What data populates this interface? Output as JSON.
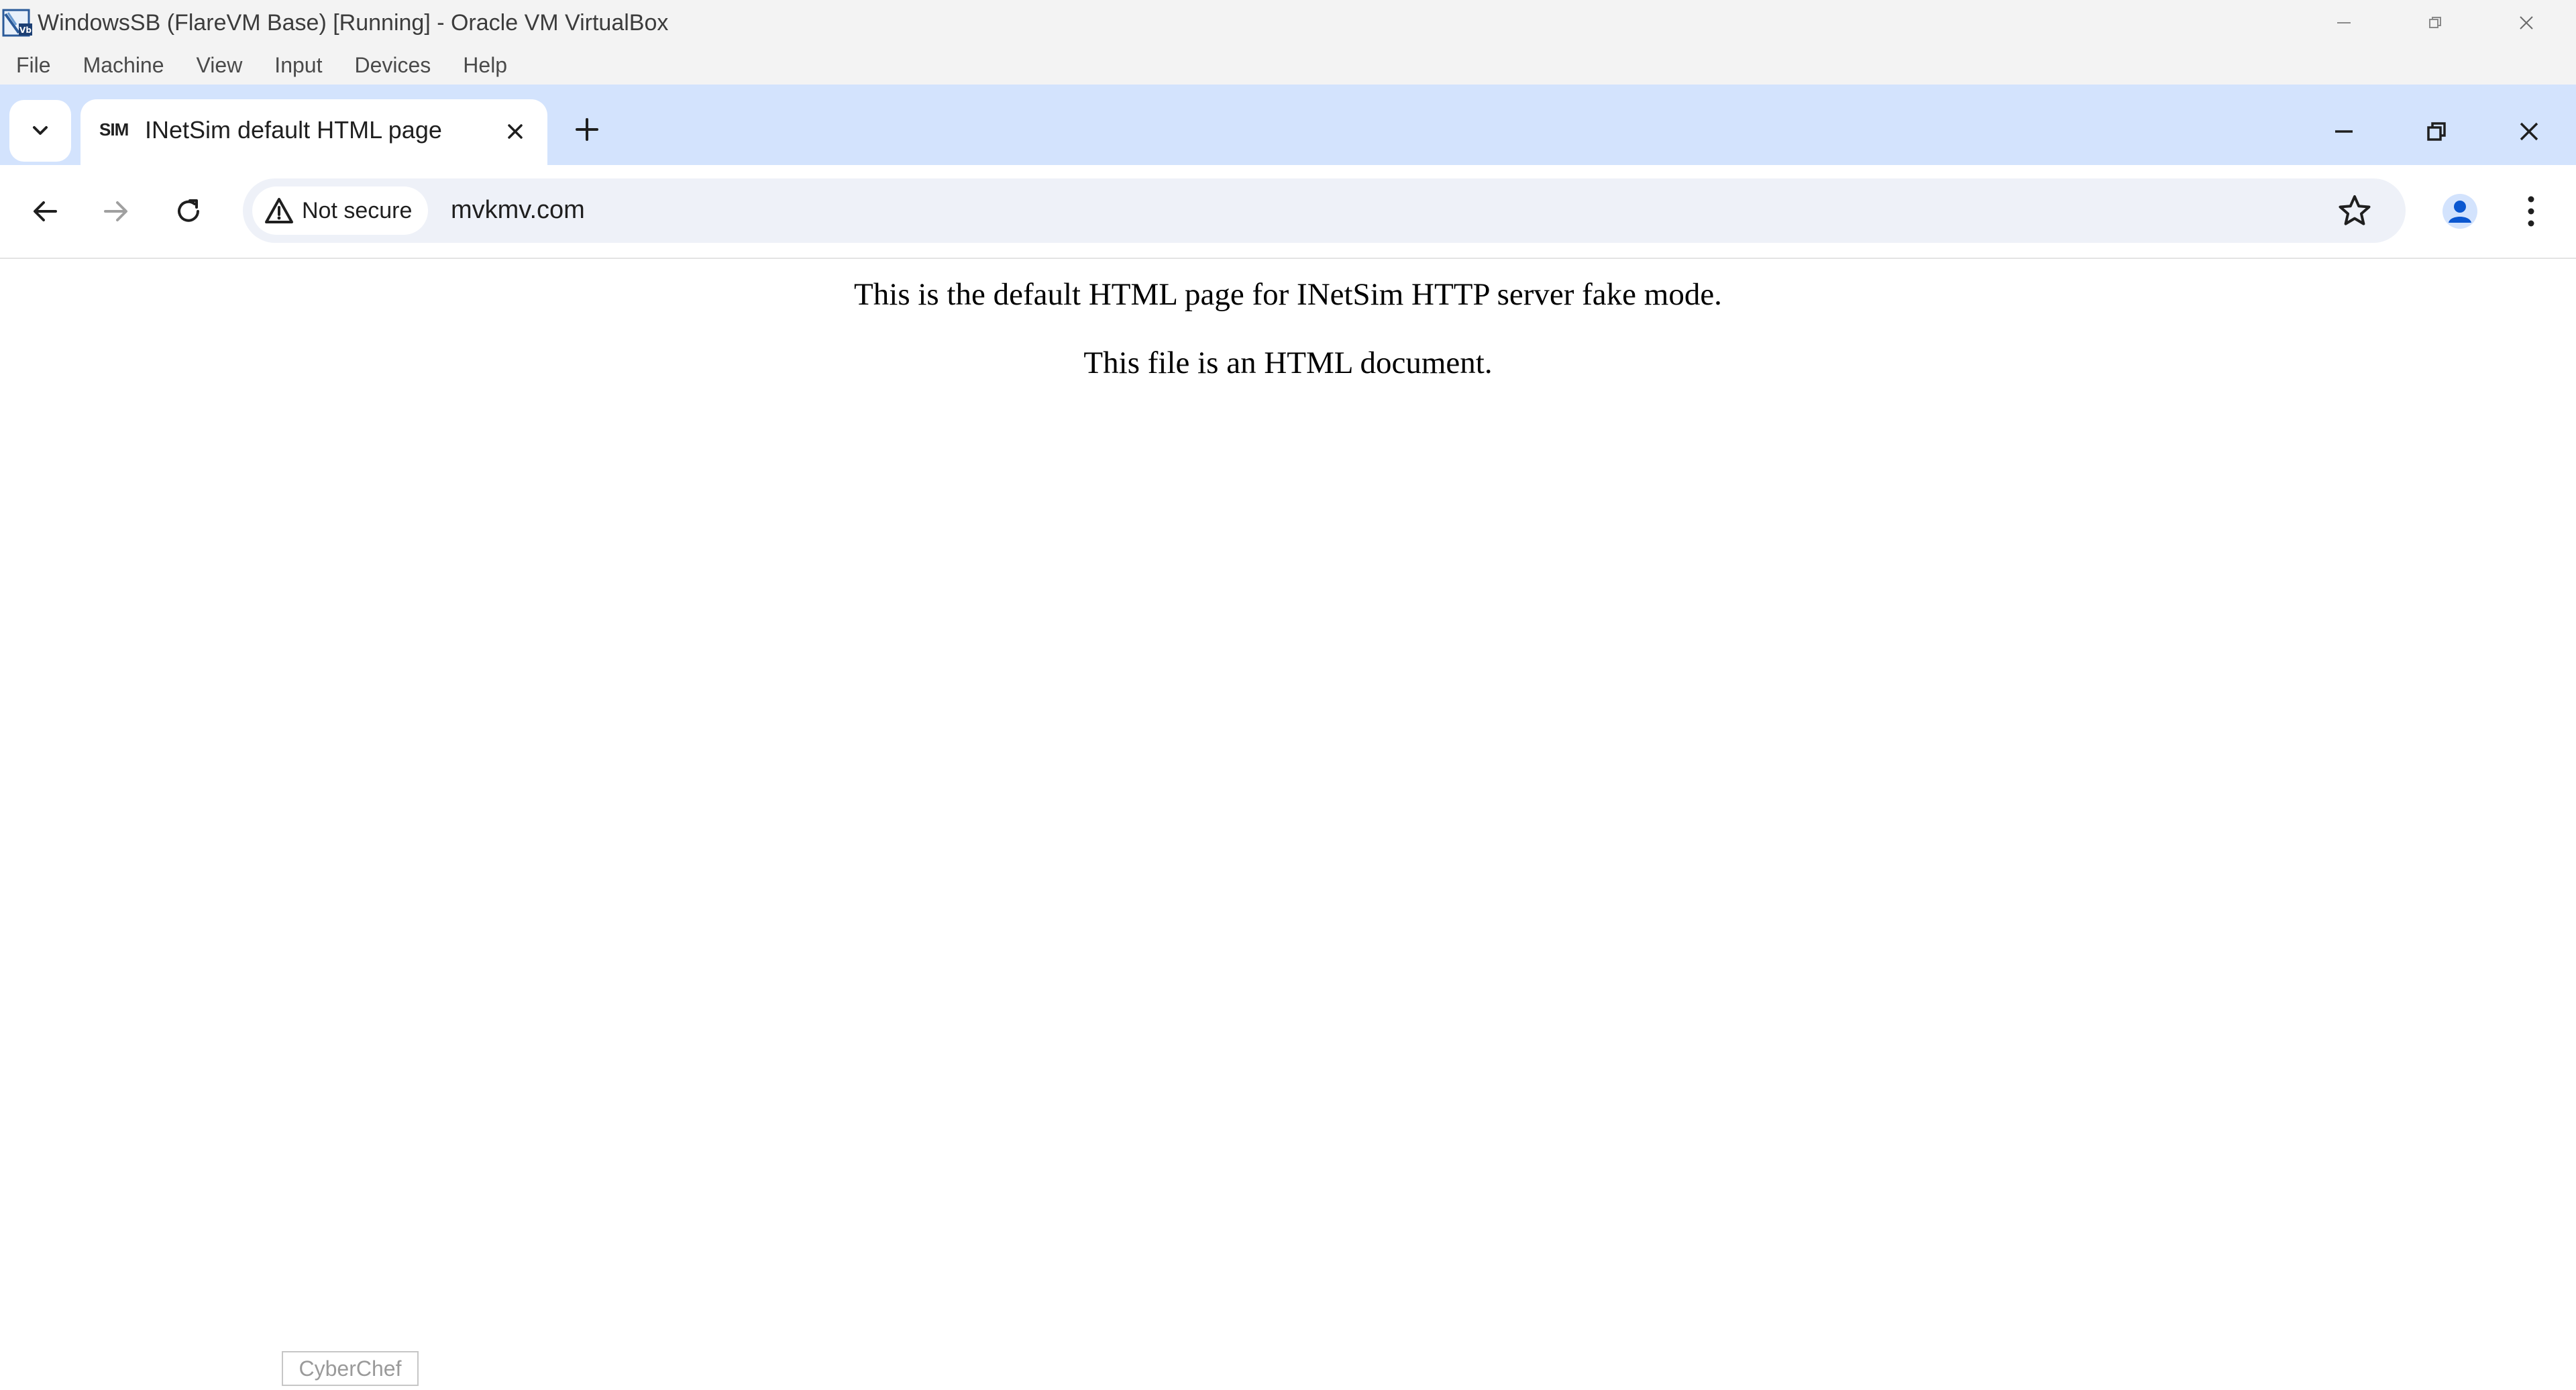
{
  "host_window": {
    "title": "WindowsSB (FlareVM Base) [Running] - Oracle VM VirtualBox",
    "menu": [
      "File",
      "Machine",
      "View",
      "Input",
      "Devices",
      "Help"
    ]
  },
  "browser": {
    "tab": {
      "favicon_text": "SIM",
      "title": "INetSim default HTML page"
    },
    "address_bar": {
      "security_label": "Not secure",
      "url": "mvkmv.com"
    }
  },
  "page": {
    "lines": [
      "This is the default HTML page for INetSim HTTP server fake mode.",
      "This file is an HTML document."
    ]
  },
  "taskbar_tooltip": "CyberChef",
  "colors": {
    "tabstrip_bg": "#d3e3fd",
    "omnibox_bg": "#eef1f8",
    "profile_accent": "#0b57d0"
  },
  "icons": [
    "virtualbox-icon",
    "tab-search-icon",
    "close-icon",
    "plus-icon",
    "minimize-icon",
    "restore-icon",
    "back-arrow-icon",
    "forward-arrow-icon",
    "reload-icon",
    "warning-icon",
    "star-icon",
    "profile-icon",
    "kebab-menu-icon"
  ]
}
